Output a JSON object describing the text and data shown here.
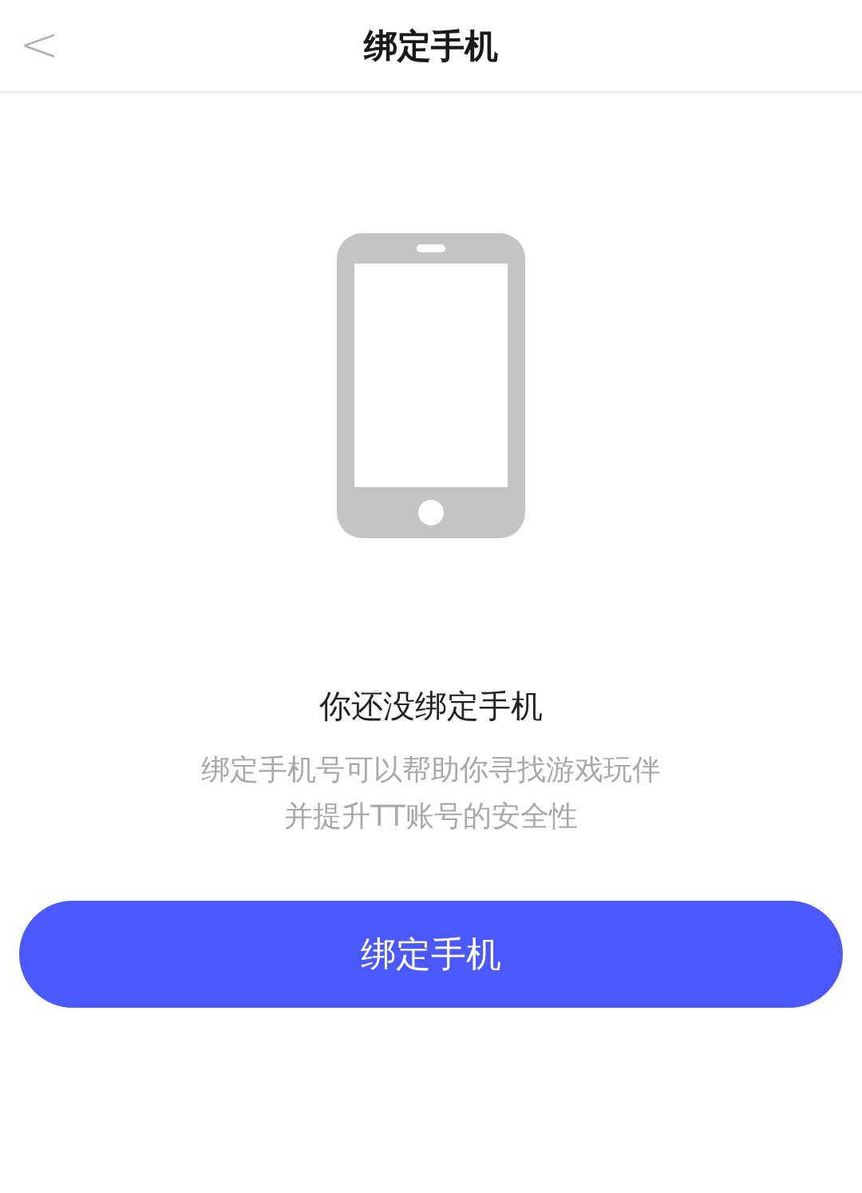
{
  "header": {
    "back": "<",
    "title": "绑定手机"
  },
  "empty_state": {
    "heading": "你还没绑定手机",
    "description_lines": [
      "绑定手机号可以帮助你寻找游戏玩伴",
      "并提升TT账号的安全性"
    ]
  },
  "primary_button": {
    "label": "绑定手机"
  }
}
